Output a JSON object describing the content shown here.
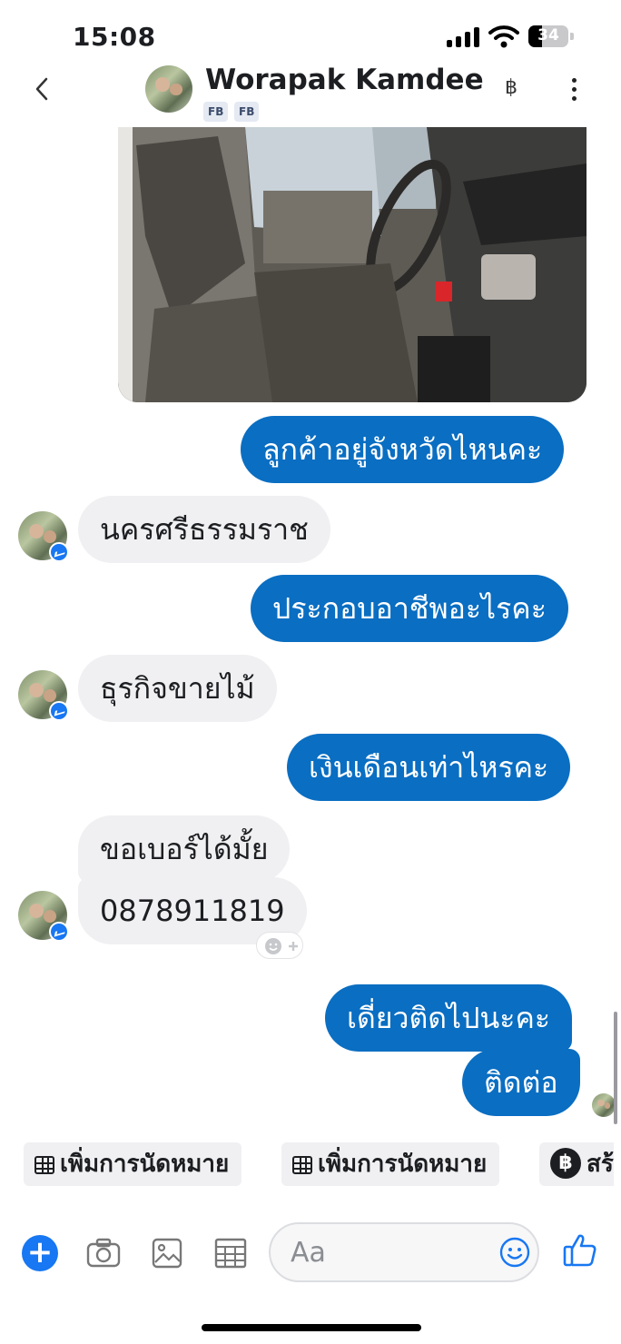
{
  "status_bar": {
    "time": "15:08",
    "battery": "34",
    "battery_level": 0.34
  },
  "header": {
    "contact_name": "Worapak Kamdee",
    "tags": [
      "FB",
      "FB"
    ],
    "currency_symbol": "฿"
  },
  "messages": [
    {
      "side": "out",
      "text": "ลูกค้าอยู่จังหวัดไหนคะ"
    },
    {
      "side": "in",
      "text": "นครศรีธรรมราช"
    },
    {
      "side": "out",
      "text": "ประกอบอาชีพอะไรคะ"
    },
    {
      "side": "in",
      "text": "ธุรกิจขายไม้"
    },
    {
      "side": "out",
      "text": "เงินเดือนเท่าไหรคะ"
    },
    {
      "side": "in",
      "text": "ขอเบอร์ได้มั้ย"
    },
    {
      "side": "in",
      "text": "0878911819"
    },
    {
      "side": "out",
      "text": "เดี่ยวติดไปนะคะ"
    },
    {
      "side": "out",
      "text": "ติดต่อ"
    }
  ],
  "quick_replies": [
    {
      "label": "เพิ่มการนัดหมาย",
      "icon": "calendar-icon"
    },
    {
      "label": "เพิ่มการนัดหมาย",
      "icon": "calendar-icon"
    },
    {
      "label": "สร้",
      "icon": "baht-icon"
    }
  ],
  "composer": {
    "placeholder": "Aa"
  },
  "colors": {
    "outgoing": "#0a6ec2",
    "incoming": "#f0f0f2",
    "accent": "#1877f2"
  }
}
